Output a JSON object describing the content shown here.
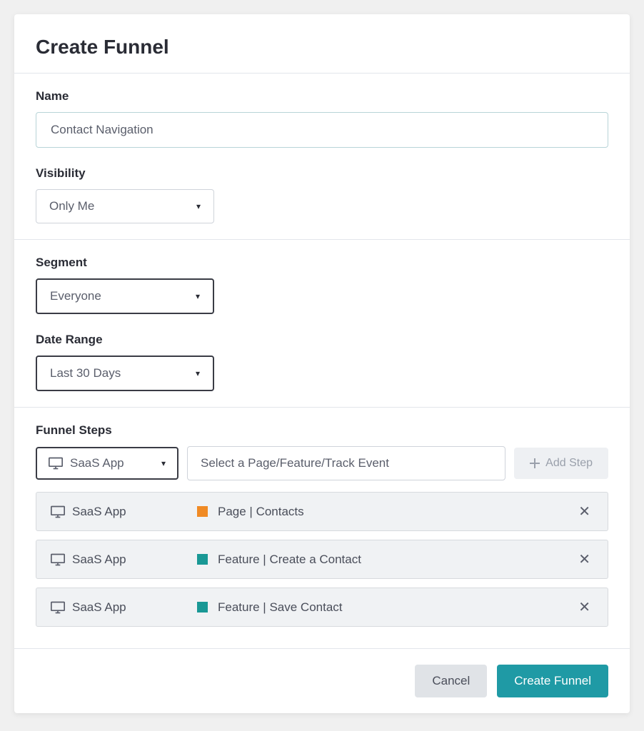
{
  "modal": {
    "title": "Create Funnel"
  },
  "fields": {
    "name_label": "Name",
    "name_value": "Contact Navigation",
    "visibility_label": "Visibility",
    "visibility_value": "Only Me",
    "segment_label": "Segment",
    "segment_value": "Everyone",
    "daterange_label": "Date Range",
    "daterange_value": "Last 30 Days"
  },
  "steps": {
    "label": "Funnel Steps",
    "app_select": "SaaS App",
    "event_placeholder": "Select a Page/Feature/Track Event",
    "add_step_label": "Add Step",
    "items": [
      {
        "app": "SaaS App",
        "color": "#f08a24",
        "detail": "Page | Contacts"
      },
      {
        "app": "SaaS App",
        "color": "#199895",
        "detail": "Feature | Create a Contact"
      },
      {
        "app": "SaaS App",
        "color": "#199895",
        "detail": "Feature | Save Contact"
      }
    ]
  },
  "footer": {
    "cancel": "Cancel",
    "submit": "Create Funnel"
  }
}
